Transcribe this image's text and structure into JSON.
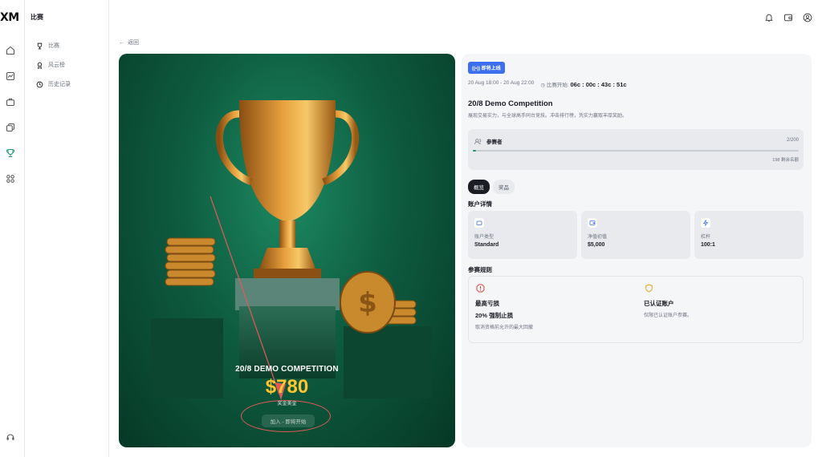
{
  "app": {
    "logo": "XM",
    "section_title": "比赛"
  },
  "rail": {
    "icons": [
      "home-icon",
      "chart-icon",
      "briefcase-icon",
      "copy-icon",
      "trophy-icon",
      "apps-icon",
      "support-icon"
    ],
    "active": "trophy-icon"
  },
  "nav": {
    "items": [
      {
        "label": "比赛",
        "icon": "trophy-icon"
      },
      {
        "label": "风云榜",
        "icon": "medal-icon"
      },
      {
        "label": "历史记录",
        "icon": "history-icon"
      }
    ]
  },
  "header": {
    "icons": [
      "bell-icon",
      "wallet-icon",
      "user-icon"
    ]
  },
  "back": {
    "label": "返回"
  },
  "hero": {
    "title": "20/8 DEMO COMPETITION",
    "amount": "$780",
    "sub": "奖金美金",
    "join_label": "加入 - 即将开始"
  },
  "details": {
    "badge": "即将上线",
    "date_range": "20 Aug 18:00 - 20 Aug 22:00",
    "countdown_label": "比赛开始:",
    "countdown": "06c : 00c : 43c : 51c",
    "title": "20/8 Demo Competition",
    "description": "展现交易实力，与全球高手同台竞技。冲击排行榜，凭实力赢取丰厚奖励。",
    "participants_label": "参赛者",
    "participants_count": "2/200",
    "participants_progress": 0.01,
    "remaining": "198 剩余名额",
    "tabs": [
      {
        "label": "概览",
        "active": true
      },
      {
        "label": "奖品",
        "active": false
      }
    ],
    "account_section": "账户详情",
    "account_cards": [
      {
        "icon": "wallet-icon",
        "label": "账户类型",
        "value": "Standard"
      },
      {
        "icon": "deposit-icon",
        "label": "净值初值",
        "value": "$5,000"
      },
      {
        "icon": "bolt-icon",
        "label": "杠杆",
        "value": "100:1"
      }
    ],
    "rules_section": "参赛规则",
    "rules": [
      {
        "icon": "alert-icon",
        "title": "最高亏损",
        "value": "20% 强制止损",
        "desc": "取消资格前允许的最大回撤"
      },
      {
        "icon": "shield-icon",
        "title": "已认证账户",
        "value": "",
        "desc": "仅限已认证账户参赛。"
      }
    ]
  },
  "colors": {
    "accent_green": "#1a9a6c",
    "badge_blue": "#3b6ff0",
    "gold": "#ffc52e",
    "annotation_red": "#e05a5a"
  }
}
